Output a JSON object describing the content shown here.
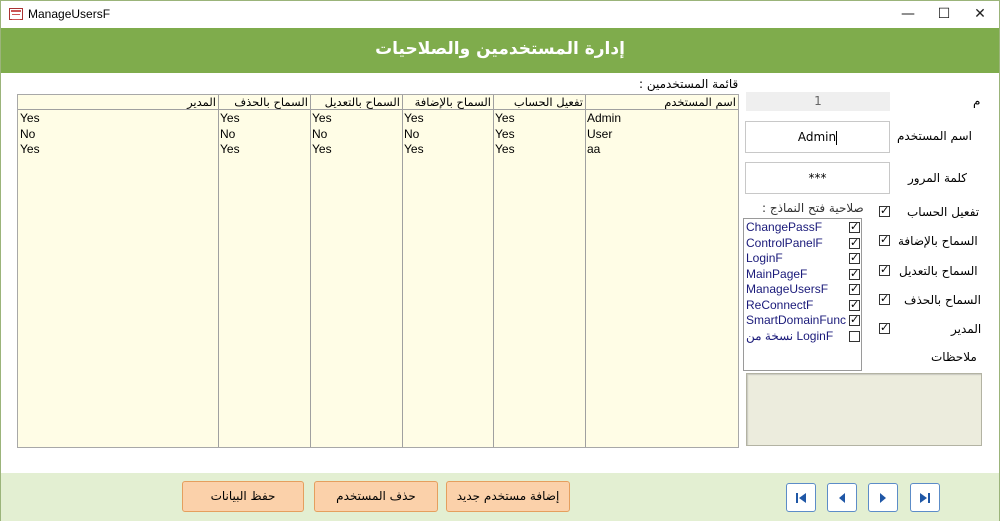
{
  "window": {
    "title": "ManageUsersF",
    "minimize": "—",
    "maximize": "☐",
    "close": "✕"
  },
  "header": {
    "title": "إدارة المستخدمين والصلاحيات"
  },
  "form": {
    "id_label": "م",
    "id_value": "1",
    "username_label": "اسم المستخدم",
    "username_value": "Admin",
    "password_label": "كلمة المرور",
    "password_value": "***",
    "forms_permission_label": "صلاحية فتح النماذج :",
    "notes_label": "ملاحظات",
    "notes_value": "",
    "permissions": [
      {
        "label": "تفعيل الحساب",
        "checked": true
      },
      {
        "label": "السماح بالإضافة",
        "checked": true
      },
      {
        "label": "السماح بالتعديل",
        "checked": true
      },
      {
        "label": "السماح بالحذف",
        "checked": true
      },
      {
        "label": "المدير",
        "checked": true
      }
    ],
    "forms_list": [
      {
        "name": "ChangePassF",
        "checked": true
      },
      {
        "name": "ControlPanelF",
        "checked": true
      },
      {
        "name": "LoginF",
        "checked": true
      },
      {
        "name": "MainPageF",
        "checked": true
      },
      {
        "name": "ManageUsersF",
        "checked": true
      },
      {
        "name": "ReConnectF",
        "checked": true
      },
      {
        "name": "SmartDomainFunc",
        "checked": true
      },
      {
        "name": "نسخة من  LoginF",
        "checked": false
      }
    ]
  },
  "users_grid": {
    "label": "قائمة المستخدمين :",
    "columns": [
      "اسم المستخدم",
      "تفعيل الحساب",
      "السماح بالإضافة",
      "السماح بالتعديل",
      "السماح بالحذف",
      "المدير"
    ],
    "rows": [
      [
        "Admin",
        "Yes",
        "Yes",
        "Yes",
        "Yes",
        "Yes"
      ],
      [
        "User",
        "Yes",
        "No",
        "No",
        "No",
        "No"
      ],
      [
        "aa",
        "Yes",
        "Yes",
        "Yes",
        "Yes",
        "Yes"
      ]
    ]
  },
  "footer": {
    "save": "حفظ البيانات",
    "delete": "حذف المستخدم",
    "add": "إضافة مستخدم جديد",
    "nav": [
      "first-record",
      "previous-record",
      "next-record",
      "last-record"
    ]
  },
  "colors": {
    "header": "#7fac4c",
    "footer": "#e3efd2",
    "grid_bg": "#fffde6",
    "action_button": "#fbd1aa",
    "nav_icon": "#1f57a6"
  }
}
